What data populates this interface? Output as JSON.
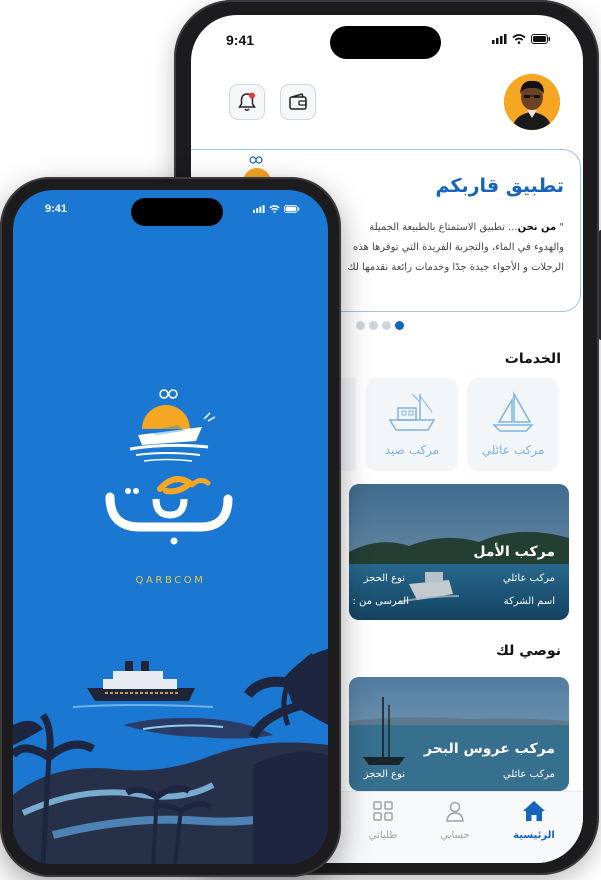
{
  "back_phone": {
    "status": {
      "time": "9:41"
    },
    "header": {
      "notification_icon": "bell-icon",
      "wallet_icon": "wallet-icon",
      "avatar_icon": "user-avatar"
    },
    "about": {
      "title": "تطبيق قاربكم",
      "line1_bold": "من نحن",
      "line1_rest": "... تطبيق الاستمتاع بالطبيعة الجميلة",
      "line2": "والهدوء في الماء، والتجربة الفريدة التي توفرها هذه",
      "line3": "الرحلات و الأجواء جيدة جدًا وخدمات رائعة نقدمها لك"
    },
    "services": {
      "title": "الخدمات",
      "items": [
        {
          "label": "مركب عائلي"
        },
        {
          "label": "مركب صيد"
        }
      ]
    },
    "featured_boat": {
      "name": "مركب الأمل",
      "type": "مركب عائلي",
      "booking_type": "نوع الحجز",
      "company": "اسم الشركة",
      "departure": "المرسى من :"
    },
    "recommended": {
      "title": "نوصي لك",
      "boat": {
        "name": "مركب عروس البحر",
        "type": "مركب عائلي",
        "booking_type": "نوع الحجز"
      }
    },
    "tabbar": {
      "home": "الرئيسية",
      "account": "حسابي",
      "orders": "طلباتي"
    },
    "colors": {
      "accent": "#1565c0",
      "service_text": "#7db3e3"
    }
  },
  "front_phone": {
    "status": {
      "time": "9:41"
    },
    "brand": "QARBCOM",
    "logo_arabic": "قارب كم",
    "colors": {
      "background": "#1a78d2",
      "logo_orange": "#f5a623",
      "brand_text": "#e7c64b"
    }
  }
}
